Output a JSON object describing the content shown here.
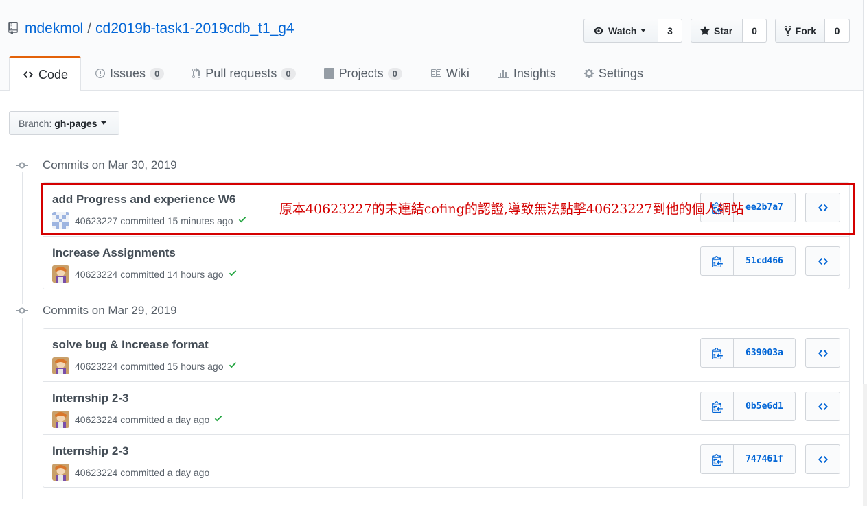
{
  "repo": {
    "owner": "mdekmol",
    "separator": "/",
    "name": "cd2019b-task1-2019cdb_t1_g4"
  },
  "actions": {
    "watch_label": "Watch",
    "watch_count": "3",
    "star_label": "Star",
    "star_count": "0",
    "fork_label": "Fork",
    "fork_count": "0"
  },
  "tabs": [
    {
      "label": "Code",
      "icon": "code-icon"
    },
    {
      "label": "Issues",
      "count": "0",
      "icon": "issue-icon"
    },
    {
      "label": "Pull requests",
      "count": "0",
      "icon": "pull-request-icon"
    },
    {
      "label": "Projects",
      "count": "0",
      "icon": "project-icon"
    },
    {
      "label": "Wiki",
      "icon": "book-icon"
    },
    {
      "label": "Insights",
      "icon": "graph-icon"
    },
    {
      "label": "Settings",
      "icon": "gear-icon"
    }
  ],
  "branch": {
    "label": "Branch:",
    "value": "gh-pages"
  },
  "groups": [
    {
      "heading": "Commits on Mar 30, 2019",
      "commits": [
        {
          "message": "add Progress and experience W6",
          "author": "40623227",
          "time": "committed 15 minutes ago",
          "sha": "ee2b7a7",
          "verified": true
        },
        {
          "message": "Increase Assignments",
          "author": "40623224",
          "time": "committed 14 hours ago",
          "sha": "51cd466",
          "verified": true
        }
      ]
    },
    {
      "heading": "Commits on Mar 29, 2019",
      "commits": [
        {
          "message": "solve bug & Increase format",
          "author": "40623224",
          "time": "committed 15 hours ago",
          "sha": "639003a",
          "verified": true
        },
        {
          "message": "Internship 2-3",
          "author": "40623224",
          "time": "committed a day ago",
          "sha": "0b5e6d1",
          "verified": true
        },
        {
          "message": "Internship 2-3",
          "author": "40623224",
          "time": "committed a day ago",
          "sha": "747461f",
          "verified": false
        }
      ]
    }
  ],
  "annotation": "原本40623227的未連結cofing的認證,導致無法點擊40623227到他的個人網站",
  "colors": {
    "link": "#0366d6",
    "annotation": "#d40000",
    "tab_accent": "#e36209",
    "check": "#28a745"
  }
}
